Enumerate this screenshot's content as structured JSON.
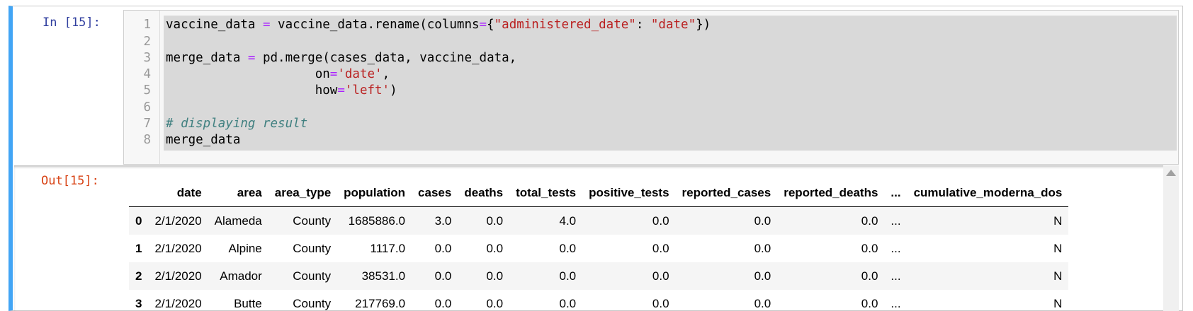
{
  "prompts": {
    "input": "In [15]:",
    "output": "Out[15]:"
  },
  "code_lines": [
    {
      "num": "1",
      "tokens": [
        [
          "vaccine_data ",
          ""
        ],
        [
          "=",
          "op"
        ],
        [
          " vaccine_data.rename(columns",
          ""
        ],
        [
          "=",
          "op"
        ],
        [
          "{",
          ""
        ],
        [
          "\"administered_date\"",
          "str"
        ],
        [
          ": ",
          ""
        ],
        [
          "\"date\"",
          "str"
        ],
        [
          "})",
          ""
        ]
      ]
    },
    {
      "num": "2",
      "tokens": []
    },
    {
      "num": "3",
      "tokens": [
        [
          "merge_data ",
          ""
        ],
        [
          "=",
          "op"
        ],
        [
          " pd.merge(cases_data, vaccine_data,",
          ""
        ]
      ]
    },
    {
      "num": "4",
      "tokens": [
        [
          "                    on",
          ""
        ],
        [
          "=",
          "op"
        ],
        [
          "'date'",
          "str"
        ],
        [
          ",",
          ""
        ]
      ]
    },
    {
      "num": "5",
      "tokens": [
        [
          "                    how",
          ""
        ],
        [
          "=",
          "op"
        ],
        [
          "'left'",
          "str"
        ],
        [
          ")",
          ""
        ]
      ]
    },
    {
      "num": "6",
      "tokens": []
    },
    {
      "num": "7",
      "tokens": [
        [
          "# displaying result",
          "cm"
        ]
      ]
    },
    {
      "num": "8",
      "tokens": [
        [
          "merge_data",
          ""
        ]
      ]
    }
  ],
  "table": {
    "columns": [
      "",
      "date",
      "area",
      "area_type",
      "population",
      "cases",
      "deaths",
      "total_tests",
      "positive_tests",
      "reported_cases",
      "reported_deaths",
      "...",
      "cumulative_moderna_dos"
    ],
    "rows": [
      [
        "0",
        "2/1/2020",
        "Alameda",
        "County",
        "1685886.0",
        "3.0",
        "0.0",
        "4.0",
        "0.0",
        "0.0",
        "0.0",
        "...",
        "N"
      ],
      [
        "1",
        "2/1/2020",
        "Alpine",
        "County",
        "1117.0",
        "0.0",
        "0.0",
        "0.0",
        "0.0",
        "0.0",
        "0.0",
        "...",
        "N"
      ],
      [
        "2",
        "2/1/2020",
        "Amador",
        "County",
        "38531.0",
        "0.0",
        "0.0",
        "0.0",
        "0.0",
        "0.0",
        "0.0",
        "...",
        "N"
      ],
      [
        "3",
        "2/1/2020",
        "Butte",
        "County",
        "217769.0",
        "0.0",
        "0.0",
        "0.0",
        "0.0",
        "0.0",
        "0.0",
        "...",
        "N"
      ]
    ]
  }
}
